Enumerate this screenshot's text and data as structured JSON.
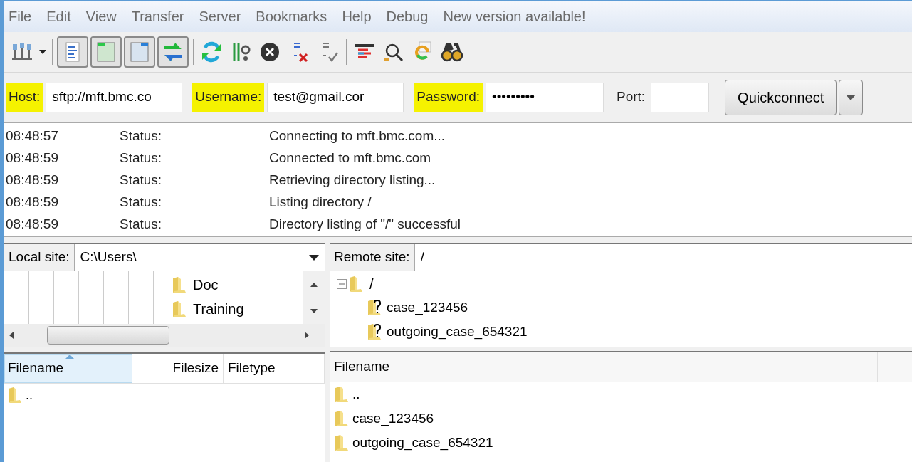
{
  "menu": [
    "File",
    "Edit",
    "View",
    "Transfer",
    "Server",
    "Bookmarks",
    "Help",
    "Debug",
    "New version available!"
  ],
  "toolbar": [
    {
      "kind": "site-manager",
      "pressed": false
    },
    {
      "kind": "dropdown",
      "pressed": false
    },
    {
      "kind": "message-log",
      "pressed": true
    },
    {
      "kind": "local-tree",
      "pressed": true
    },
    {
      "kind": "remote-tree",
      "pressed": true
    },
    {
      "kind": "transfer-queue",
      "pressed": true
    },
    {
      "kind": "refresh",
      "pressed": false
    },
    {
      "kind": "process-queue",
      "pressed": false
    },
    {
      "kind": "cancel",
      "pressed": false
    },
    {
      "kind": "disconnect",
      "pressed": false
    },
    {
      "kind": "reconnect",
      "pressed": false
    },
    {
      "kind": "filter",
      "pressed": false
    },
    {
      "kind": "compare",
      "pressed": false
    },
    {
      "kind": "sync",
      "pressed": false
    },
    {
      "kind": "find",
      "pressed": false
    }
  ],
  "quickconnect": {
    "fields": [
      {
        "label": "Host:",
        "highlighted": true,
        "value": "sftp://mft.bmc.co"
      },
      {
        "label": "Username:",
        "highlighted": true,
        "value": "test@gmail.cor"
      },
      {
        "label": "Password:",
        "highlighted": true,
        "value": "•••••••••"
      },
      {
        "label": "Port:",
        "highlighted": false
      }
    ],
    "button": "Quickconnect"
  },
  "log": [
    {
      "time": "08:48:57",
      "type": "Status:",
      "message": "Connecting to mft.bmc.com..."
    },
    {
      "time": "08:48:59",
      "type": "Status:",
      "message": "Connected to mft.bmc.com"
    },
    {
      "time": "08:48:59",
      "type": "Status:",
      "message": "Retrieving directory listing..."
    },
    {
      "time": "08:48:59",
      "type": "Status:",
      "message": "Listing directory /"
    },
    {
      "time": "08:48:59",
      "type": "Status:",
      "message": "Directory listing of \"/\" successful"
    }
  ],
  "local": {
    "label": "Local site:",
    "path": "C:\\Users\\",
    "tree": [
      {
        "name": "Doc"
      },
      {
        "name": "Training"
      }
    ],
    "columns": [
      {
        "label": "Filename",
        "sorted": true
      },
      {
        "label": "Filesize",
        "sorted": false
      },
      {
        "label": "Filetype",
        "sorted": false
      }
    ],
    "rows": [
      ".."
    ]
  },
  "remote": {
    "label": "Remote site:",
    "path": "/",
    "tree": {
      "name": "/",
      "expanded": true,
      "children": [
        {
          "name": "case_123456"
        },
        {
          "name": "outgoing_case_654321"
        }
      ]
    },
    "columns": [
      {
        "label": "Filename",
        "sorted": false
      }
    ],
    "rows": [
      "..",
      "case_123456",
      "outgoing_case_654321"
    ]
  }
}
